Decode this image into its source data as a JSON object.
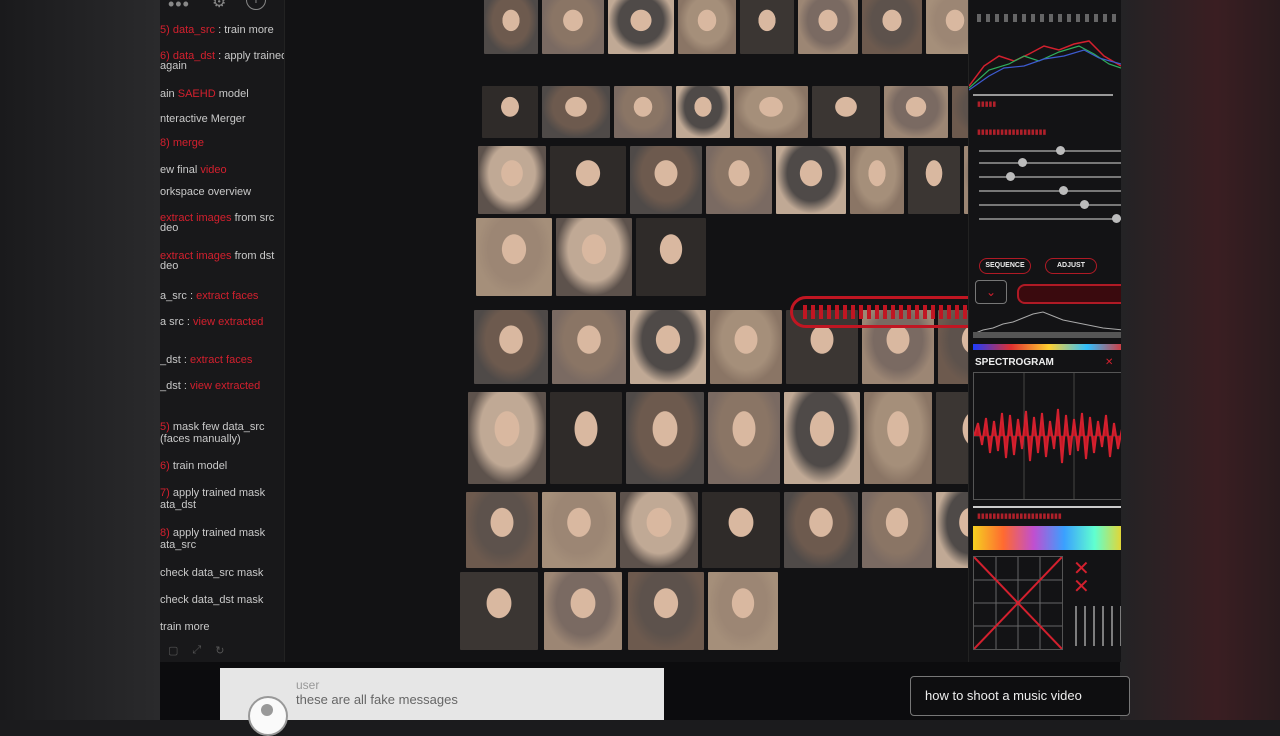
{
  "sidebar": {
    "steps": [
      {
        "pre": "",
        "red": "5) data_src",
        "post": " : train more"
      },
      {
        "pre": "",
        "red": "6) data_dst",
        "post": " : apply trained mask"
      },
      {
        "pre": "again",
        "red": "",
        "post": ""
      },
      {
        "pre": "ain ",
        "red": "SAEHD",
        "post": " model"
      },
      {
        "pre": "nteractive Merger",
        "red": "",
        "post": ""
      },
      {
        "pre": "",
        "red": "8) merge",
        "post": ""
      },
      {
        "pre": "ew final ",
        "red": "video",
        "post": ""
      },
      {
        "pre": "orkspace overview",
        "red": "",
        "post": ""
      },
      {
        "pre": "",
        "red": "extract images",
        "post": " from src"
      },
      {
        "pre": "deo",
        "red": "",
        "post": ""
      },
      {
        "pre": "",
        "red": "extract images",
        "post": " from dst"
      },
      {
        "pre": "deo",
        "red": "",
        "post": ""
      },
      {
        "pre": "a_src : ",
        "red": "extract faces",
        "post": ""
      },
      {
        "pre": "a src : ",
        "red": "view extracted",
        "post": ""
      },
      {
        "pre": "_dst : ",
        "red": "extract faces",
        "post": ""
      },
      {
        "pre": "_dst : ",
        "red": "view extracted",
        "post": ""
      },
      {
        "pre": "",
        "red": "5)",
        "post": " mask few data_src"
      },
      {
        "pre": "(faces manually)",
        "red": "",
        "post": ""
      },
      {
        "pre": "",
        "red": "6)",
        "post": " train model"
      },
      {
        "pre": "",
        "red": "7)",
        "post": " apply trained mask"
      },
      {
        "pre": "ata_dst",
        "red": "",
        "post": ""
      },
      {
        "pre": "",
        "red": "8)",
        "post": " apply trained mask"
      },
      {
        "pre": "ata_src",
        "red": "",
        "post": ""
      },
      {
        "pre": "",
        "red": "",
        "post": "      check data_src mask"
      },
      {
        "pre": "",
        "red": "",
        "post": "      check data_dst mask"
      },
      {
        "pre": "",
        "red": "",
        "post": "      train more"
      }
    ]
  },
  "right_panel": {
    "sequence_label": "SEQUENCE",
    "adjust_label": "ADJUST",
    "spectrogram_label": "SPECTROGRAM",
    "sliders": [
      0.58,
      0.29,
      0.2,
      0.6,
      0.76,
      1.0
    ]
  },
  "bottom": {
    "user_label": "user",
    "message": "these are all fake messages",
    "search_value": "how to shoot a music video"
  },
  "colors": {
    "accent": "#c01622",
    "text": "#c9c9c9",
    "bg": "#121214"
  }
}
